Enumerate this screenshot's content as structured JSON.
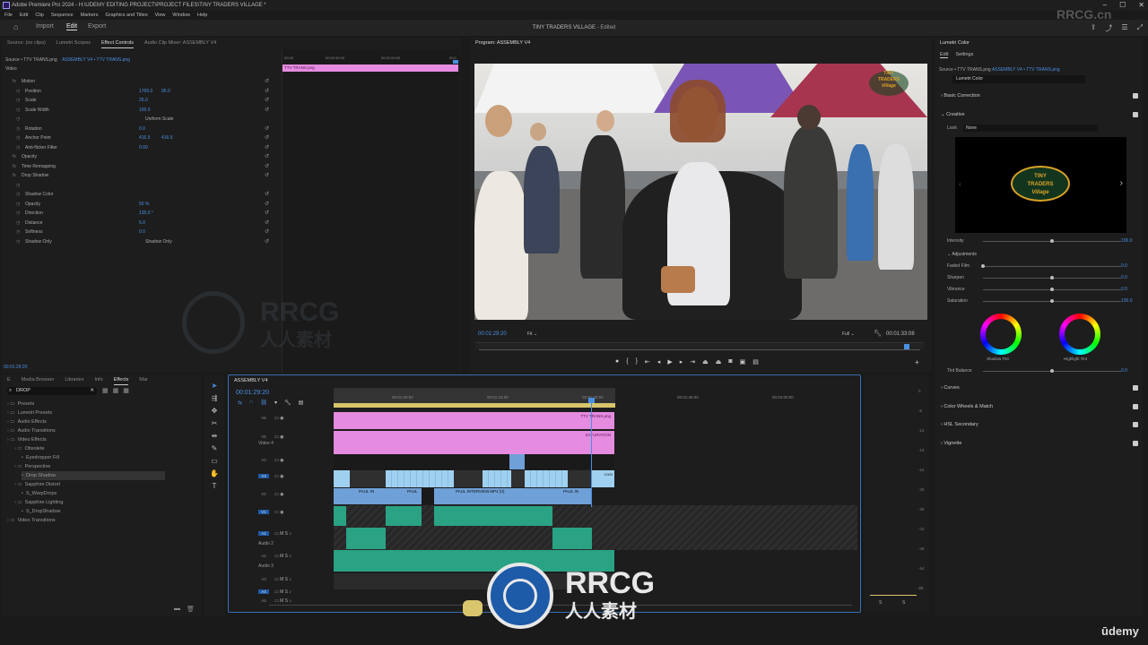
{
  "app": {
    "title": "Adobe Premiere Pro 2024 - H:\\UDEMY EDITING PROJECT\\PROJECT FILES\\TINY TRADERS VILLAGE *",
    "project": "TINY TRADERS VILLAGE",
    "edited": "- Edited",
    "watermark_top": "RRCG.cn"
  },
  "menu": [
    "File",
    "Edit",
    "Clip",
    "Sequence",
    "Markers",
    "Graphics and Titles",
    "View",
    "Window",
    "Help"
  ],
  "workspace": {
    "home": "home-icon",
    "tabs": [
      "Import",
      "Edit",
      "Export"
    ],
    "active": "Edit"
  },
  "source_tabs": [
    "Source: (no clips)",
    "Lumetri Scopes",
    "Effect Controls",
    "Audio Clip Mixer: ASSEMBLY V4"
  ],
  "effect_controls": {
    "source": "Source • TTV TRANS.png",
    "seq": "ASSEMBLY V4 • TTV TRANS.png",
    "ruler": [
      "00:00",
      "00:00:30:00",
      "00:01:00:00",
      "00:0"
    ],
    "clip": "TTV TRANS.png",
    "video": "Video",
    "rows": [
      {
        "label": "Motion",
        "v1": "",
        "v2": ""
      },
      {
        "label": "Position",
        "v1": "1765.0",
        "v2": "95.0"
      },
      {
        "label": "Scale",
        "v1": "25.0",
        "v2": ""
      },
      {
        "label": "Scale Width",
        "v1": "100.0",
        "v2": ""
      },
      {
        "label": "",
        "v1": "Uniform Scale",
        "v2": ""
      },
      {
        "label": "Rotation",
        "v1": "0.0",
        "v2": ""
      },
      {
        "label": "Anchor Point",
        "v1": "416.5",
        "v2": "416.5"
      },
      {
        "label": "Anti-flicker Filter",
        "v1": "0.00",
        "v2": ""
      },
      {
        "label": "Opacity",
        "v1": "",
        "v2": ""
      },
      {
        "label": "Time Remapping",
        "v1": "",
        "v2": ""
      },
      {
        "label": "Drop Shadow",
        "v1": "",
        "v2": ""
      },
      {
        "label": "",
        "v1": "",
        "v2": ""
      },
      {
        "label": "Shadow Color",
        "v1": "",
        "v2": ""
      },
      {
        "label": "Opacity",
        "v1": "50 %",
        "v2": ""
      },
      {
        "label": "Direction",
        "v1": "135.0 °",
        "v2": ""
      },
      {
        "label": "Distance",
        "v1": "5.0",
        "v2": ""
      },
      {
        "label": "Softness",
        "v1": "0.0",
        "v2": ""
      },
      {
        "label": "Shadow Only",
        "v1": "Shadow Only",
        "v2": ""
      }
    ],
    "timecode": "00:01:29:20"
  },
  "program": {
    "title": "Program: ASSEMBLY V4",
    "timecode": "00:01:29:20",
    "fit": "Fit",
    "full": "Full",
    "duration": "00:01:33:08",
    "logo_l1": "TINY",
    "logo_l2": "TRADERS",
    "logo_l3": "Village"
  },
  "effects_panel": {
    "tabs": [
      "E",
      "Media Browser",
      "Libraries",
      "Info",
      "Effects",
      "Mar"
    ],
    "search": "DROP",
    "tree": [
      {
        "t": "Presets",
        "d": 0
      },
      {
        "t": "Lumetri Presets",
        "d": 0
      },
      {
        "t": "Audio Effects",
        "d": 0
      },
      {
        "t": "Audio Transitions",
        "d": 0
      },
      {
        "t": "Video Effects",
        "d": 0
      },
      {
        "t": "Obsolete",
        "d": 1
      },
      {
        "t": "Eyedropper Fill",
        "d": 2
      },
      {
        "t": "Perspective",
        "d": 1
      },
      {
        "t": "Drop Shadow",
        "d": 2
      },
      {
        "t": "Sapphire Distort",
        "d": 1
      },
      {
        "t": "S_WarpDrops",
        "d": 2
      },
      {
        "t": "Sapphire Lighting",
        "d": 1
      },
      {
        "t": "S_DropShadow",
        "d": 2
      },
      {
        "t": "Video Transitions",
        "d": 0
      }
    ]
  },
  "timeline": {
    "seq": "ASSEMBLY V4",
    "timecode": "00:01:29:20",
    "ruler": [
      "00:01:00:00",
      "00:01:15:00",
      "00:01:30:00",
      "00:01:45:00",
      "00:02:00:00"
    ],
    "tracks": [
      "V6",
      "V5",
      "V4",
      "V3",
      "V2",
      "V1",
      "A1",
      "A2",
      "A3",
      "A4",
      "A5"
    ],
    "track_names": {
      "v4": "Video 4",
      "a2": "Audio 2",
      "a3": "Audio 3"
    },
    "clips": {
      "ttv": "TTV TRANS.png",
      "sat": "SATURATION",
      "paul1": "PAUL IN",
      "paul2": "PAUL",
      "paul3": "PAUL INTERVIEW.MP4 [V]",
      "paul4": "PAUL IN",
      "c000": "C000"
    }
  },
  "meter": [
    "0",
    "-6",
    "-12",
    "-18",
    "-24",
    "-30",
    "-36",
    "-42",
    "-48",
    "-54",
    "dB"
  ],
  "meter_solo": "S",
  "lumetri": {
    "title": "Lumetri Color",
    "tabs": [
      "Edit",
      "Settings"
    ],
    "source": "Source • TTV TRANS.png",
    "seq": "ASSEMBLY V4 • TTV TRANS.png",
    "preset": "Lumetri Color",
    "basic": "Basic Correction",
    "creative": "Creative",
    "look_label": "Look",
    "look": "None",
    "logo": [
      "TINY",
      "TRADERS",
      "Village"
    ],
    "sliders": [
      {
        "l": "Intensity",
        "v": "100.0",
        "p": 0.5
      },
      {
        "l": "Faded Film",
        "v": "0.0",
        "p": 0
      },
      {
        "l": "Sharpen",
        "v": "0.0",
        "p": 0.5
      },
      {
        "l": "Vibrance",
        "v": "0.0",
        "p": 0.5
      },
      {
        "l": "Saturation",
        "v": "100.0",
        "p": 0.5
      }
    ],
    "adjust": "Adjustments",
    "shadow_tint": "Shadow Tint",
    "highlight_tint": "Highlight Tint",
    "tint_balance": "Tint Balance",
    "tb_v": "0.0",
    "sections": [
      "Curves",
      "Color Wheels & Match",
      "HSL Secondary",
      "Vignette"
    ]
  },
  "watermark": {
    "brand": "RRCG",
    "cn": "人人素材"
  },
  "udemy": "ūdemy"
}
